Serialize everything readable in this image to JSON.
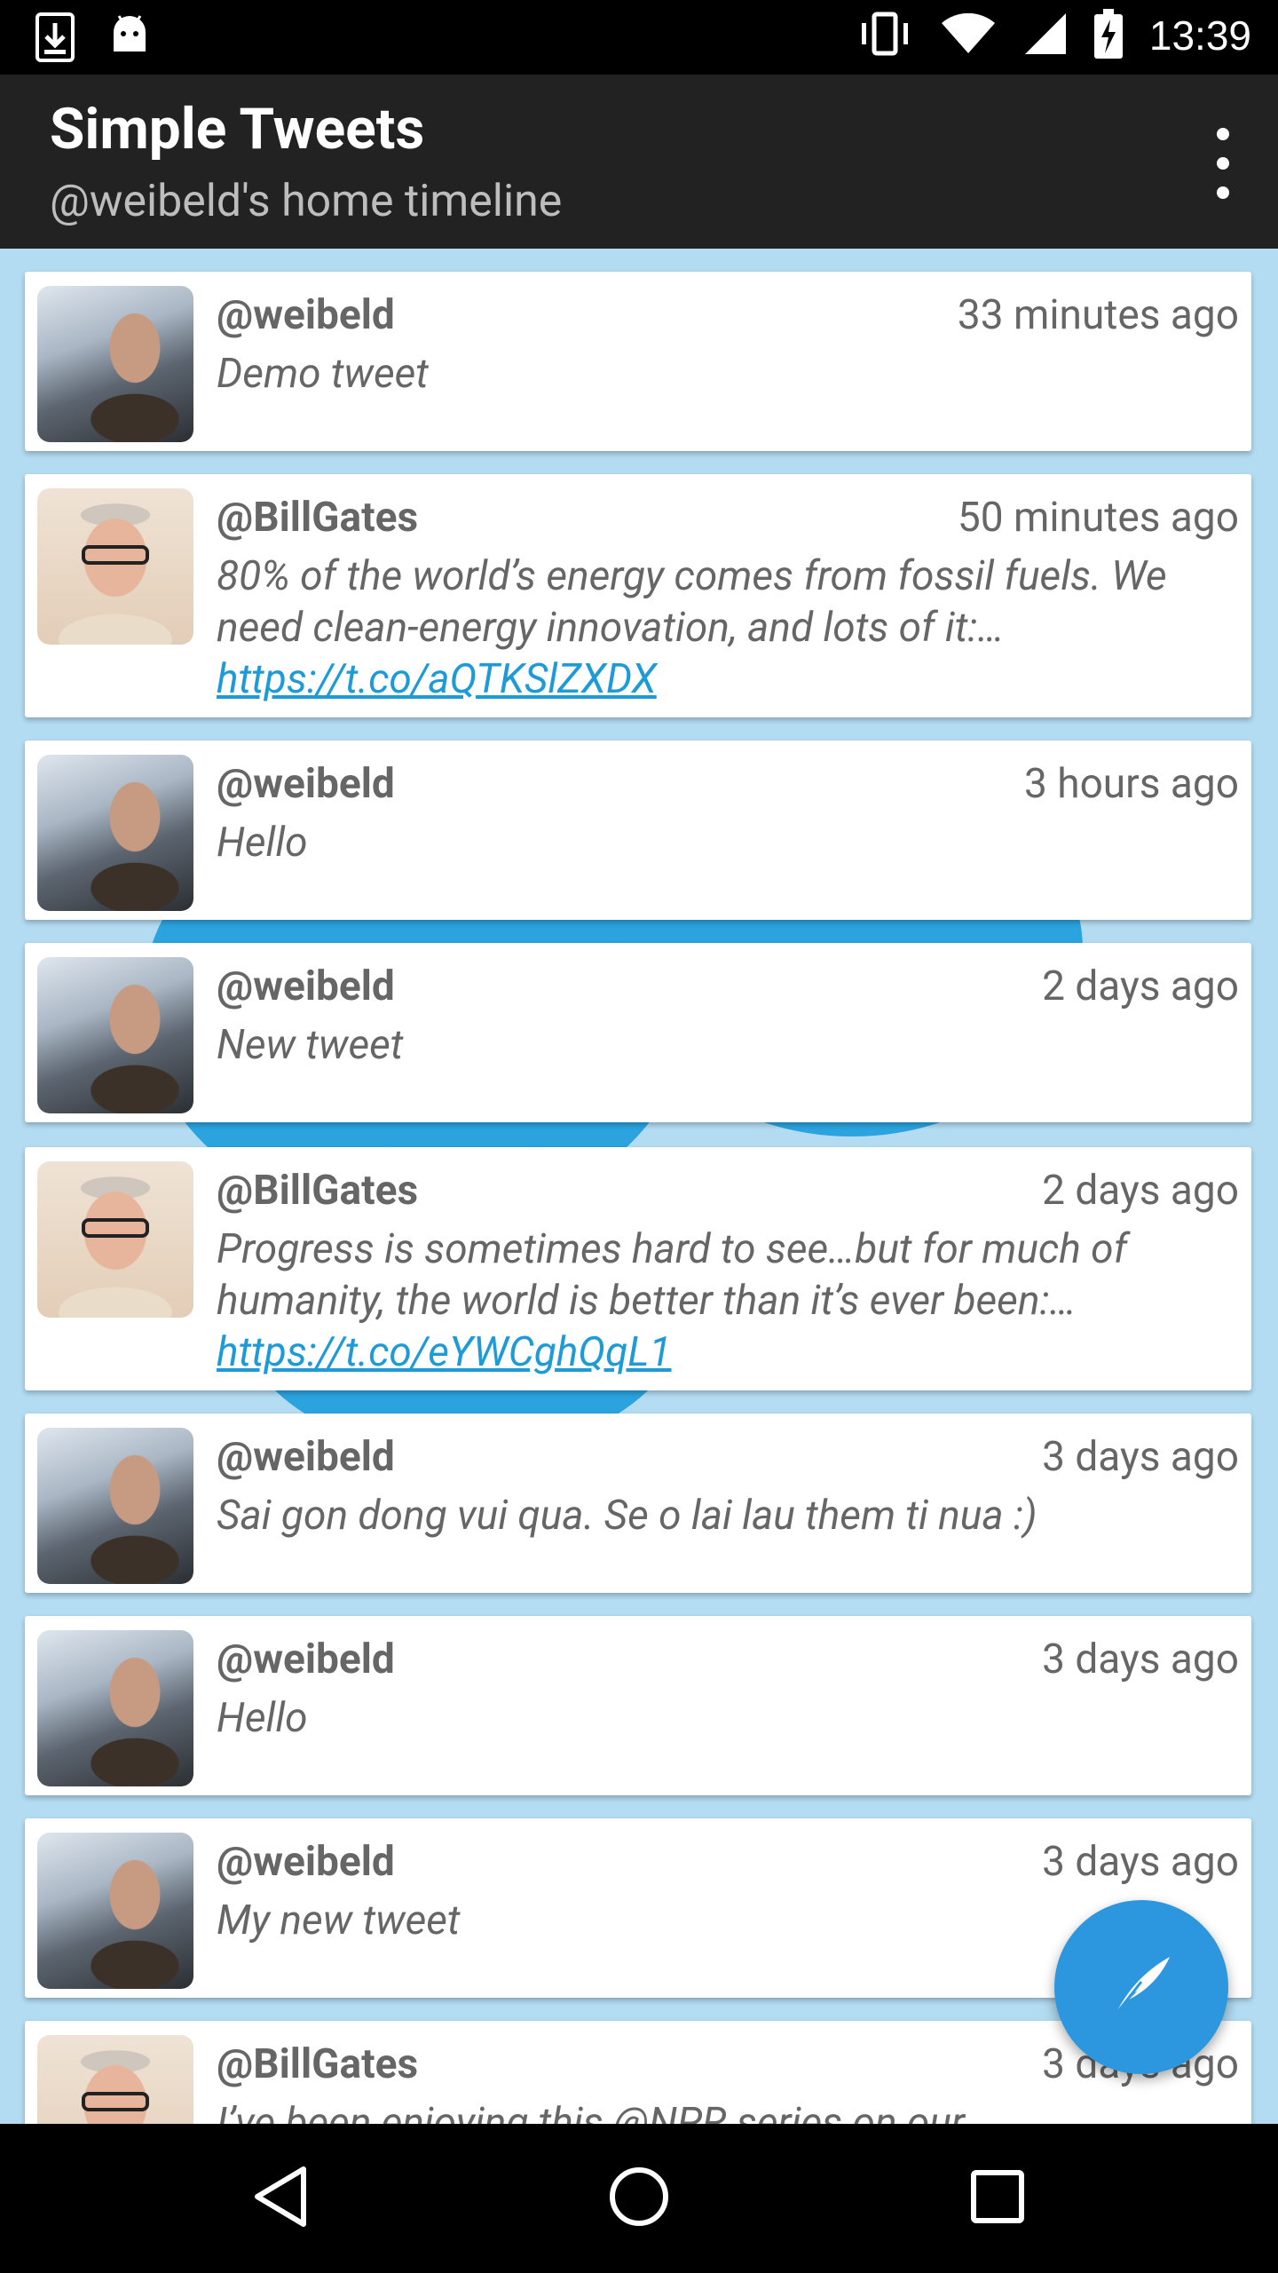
{
  "status_bar": {
    "time": "13:39",
    "icons_left": [
      "download-icon",
      "android-icon"
    ],
    "icons_right": [
      "vibrate-icon",
      "wifi-icon",
      "cell-signal-icon",
      "battery-charging-icon"
    ]
  },
  "app_bar": {
    "title": "Simple Tweets",
    "subtitle": "@weibeld's home timeline",
    "menu_icon": "overflow-menu-icon"
  },
  "tweets": [
    {
      "user": "@weibeld",
      "time": "33 minutes ago",
      "text": "Demo tweet",
      "link": ""
    },
    {
      "user": "@BillGates",
      "time": "50 minutes ago",
      "text": "80% of the world’s energy comes from fossil fuels. We need clean-energy innovation, and lots of it:… ",
      "link": "https://t.co/aQTKSlZXDX"
    },
    {
      "user": "@weibeld",
      "time": "3 hours ago",
      "text": "Hello",
      "link": ""
    },
    {
      "user": "@weibeld",
      "time": "2 days ago",
      "text": "New tweet",
      "link": ""
    },
    {
      "user": "@BillGates",
      "time": "2 days ago",
      "text": "Progress is sometimes hard to see…but for much of humanity, the world is better than it’s ever been:… ",
      "link": "https://t.co/eYWCghQqL1"
    },
    {
      "user": "@weibeld",
      "time": "3 days ago",
      "text": "Sai gon dong vui qua. Se o lai lau them ti nua :)",
      "link": ""
    },
    {
      "user": "@weibeld",
      "time": "3 days ago",
      "text": "Hello",
      "link": ""
    },
    {
      "user": "@weibeld",
      "time": "3 days ago",
      "text": "My new tweet",
      "link": ""
    },
    {
      "user": "@BillGates",
      "time": "3 days ago",
      "text": "I’ve been enjoying this @NPR series on our",
      "link": ""
    }
  ],
  "fab": {
    "icon": "compose-feather-icon",
    "color": "#2c97df"
  },
  "nav_bar": {
    "icons": [
      "back-icon",
      "home-icon",
      "recents-icon"
    ]
  },
  "colors": {
    "app_bar": "#222222",
    "timeline_bg": "#b3dbf2",
    "link": "#1e9bd7",
    "text": "#666666"
  }
}
